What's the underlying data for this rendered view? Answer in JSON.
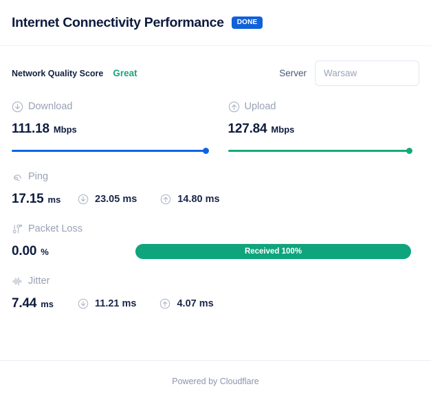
{
  "header": {
    "title": "Internet Connectivity Performance",
    "status_badge": "DONE",
    "badge_color": "#1161d9"
  },
  "score": {
    "label": "Network Quality Score",
    "value": "Great",
    "value_color": "#17a67c"
  },
  "server": {
    "label": "Server",
    "value": "Warsaw",
    "placeholder": "Warsaw"
  },
  "speeds": {
    "download": {
      "label": "Download",
      "icon": "circle-arrow-down-icon",
      "value": "111.18",
      "unit": "Mbps",
      "bar_color": "#0b63e5",
      "bar_percent": 100
    },
    "upload": {
      "label": "Upload",
      "icon": "circle-arrow-up-icon",
      "value": "127.84",
      "unit": "Mbps",
      "bar_color": "#13a97b",
      "bar_percent": 100
    }
  },
  "ping": {
    "label": "Ping",
    "icon": "ping-icon",
    "value": "17.15",
    "unit": "ms",
    "download": {
      "icon": "circle-arrow-down-icon",
      "value": "23.05 ms"
    },
    "upload": {
      "icon": "circle-arrow-up-icon",
      "value": "14.80 ms"
    }
  },
  "packet_loss": {
    "label": "Packet Loss",
    "icon": "packet-loss-icon",
    "value": "0.00",
    "unit": "%",
    "pill_text": "Received 100%",
    "pill_color": "#10a47d"
  },
  "jitter": {
    "label": "Jitter",
    "icon": "waveform-icon",
    "value": "7.44",
    "unit": "ms",
    "download": {
      "icon": "circle-arrow-down-icon",
      "value": "11.21 ms"
    },
    "upload": {
      "icon": "circle-arrow-up-icon",
      "value": "4.07 ms"
    }
  },
  "footer": {
    "text": "Powered by Cloudflare"
  }
}
